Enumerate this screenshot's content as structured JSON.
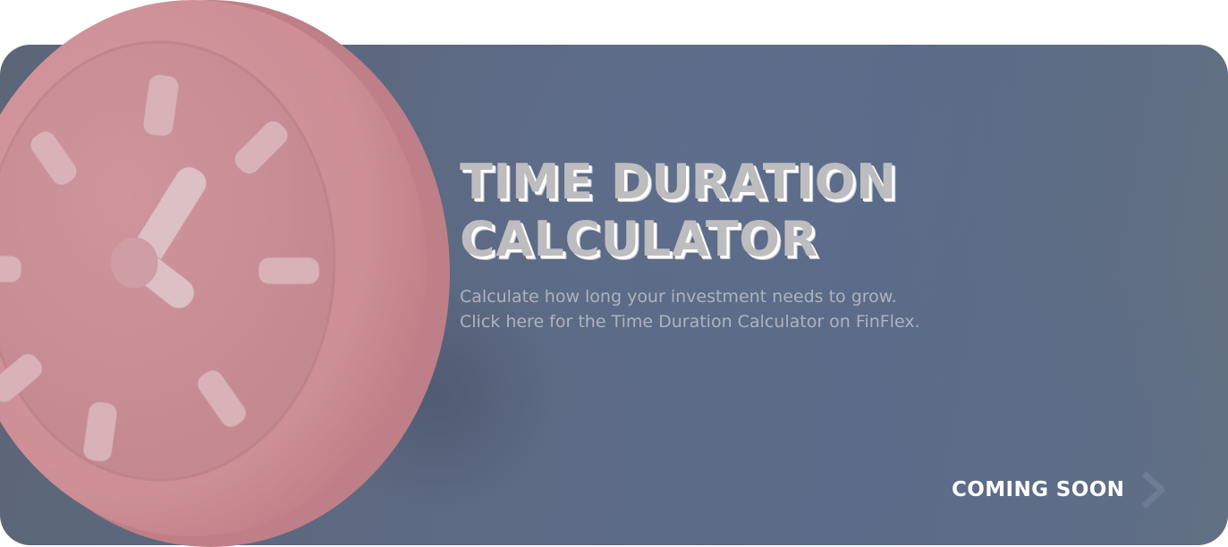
{
  "banner": {
    "title_line1": "TIME DURATION",
    "title_line2": "CALCULATOR",
    "description_line1": "Calculate how long your investment needs to grow.",
    "description_line2": "Click here for the Time Duration Calculator on FinFlex.",
    "cta_label": "COMING SOON",
    "cta_icon": "chevron-right-icon",
    "illustration": "clock-icon"
  },
  "colors": {
    "card_background": "#5c6a84",
    "clock_pink": "#cf8f97",
    "clock_face": "#c98c95",
    "title_text": "#bdbdbf",
    "description_text": "#aeb3bd",
    "cta_text": "#ffffff",
    "chevron": "#6f7b92"
  }
}
